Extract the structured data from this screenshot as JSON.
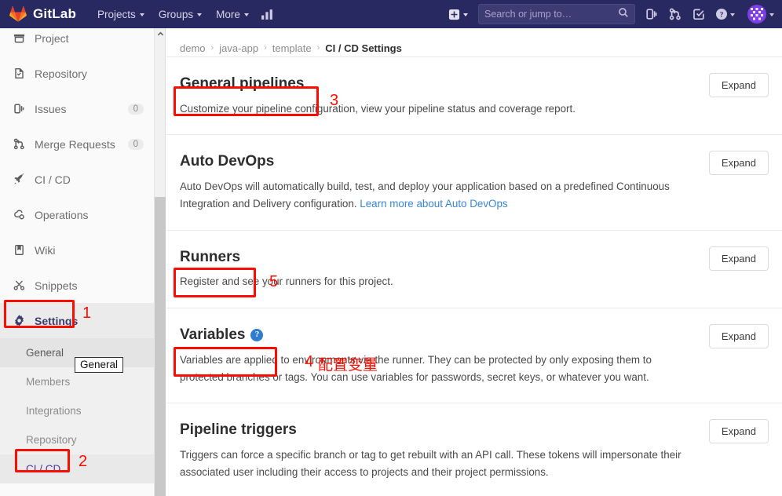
{
  "navbar": {
    "brand": "GitLab",
    "links": [
      {
        "label": "Projects",
        "icon": "chevron-down-icon"
      },
      {
        "label": "Groups",
        "icon": "chevron-down-icon"
      },
      {
        "label": "More",
        "icon": "chevron-down-icon"
      }
    ],
    "activity_icon": "analytics-chart-icon",
    "plus_icon": "plus-square-icon",
    "search": {
      "placeholder": "Search or jump to…",
      "value": "",
      "icon": "search-icon"
    },
    "right_icons": [
      {
        "name": "issues-icon"
      },
      {
        "name": "merge-request-icon"
      },
      {
        "name": "todos-check-icon"
      }
    ],
    "help_icon": "question-circle-icon",
    "avatar_icon": "user-avatar-identicon"
  },
  "sidebar": {
    "items": [
      {
        "label": "Project",
        "icon": "project-icon",
        "badge": null,
        "clipped": true
      },
      {
        "label": "Repository",
        "icon": "repository-icon",
        "badge": null
      },
      {
        "label": "Issues",
        "icon": "issues-icon",
        "badge": "0"
      },
      {
        "label": "Merge Requests",
        "icon": "merge-request-icon",
        "badge": "0"
      },
      {
        "label": "CI / CD",
        "icon": "rocket-icon",
        "badge": null
      },
      {
        "label": "Operations",
        "icon": "operations-icon",
        "badge": null
      },
      {
        "label": "Wiki",
        "icon": "wiki-book-icon",
        "badge": null
      },
      {
        "label": "Snippets",
        "icon": "snippets-scissors-icon",
        "badge": null
      },
      {
        "label": "Settings",
        "icon": "gear-icon",
        "badge": null,
        "active": true
      }
    ],
    "sub_items": [
      {
        "label": "General",
        "state": "highlighted"
      },
      {
        "label": "Members",
        "state": "normal"
      },
      {
        "label": "Integrations",
        "state": "normal"
      },
      {
        "label": "Repository",
        "state": "normal"
      },
      {
        "label": "CI / CD",
        "state": "active"
      }
    ],
    "tooltip": "General",
    "scrollbar": {
      "up_arrow_icon": "chevron-up-icon"
    }
  },
  "breadcrumb": {
    "items": [
      "demo",
      "java-app",
      "template"
    ],
    "current": "CI / CD Settings",
    "separator": "›"
  },
  "main": {
    "expand_label": "Expand",
    "sections": [
      {
        "title": "General pipelines",
        "desc": "Customize your pipeline configuration, view your pipeline status and coverage report.",
        "has_help": false
      },
      {
        "title": "Auto DevOps",
        "desc": "Auto DevOps will automatically build, test, and deploy your application based on a predefined Continuous Integration and Delivery configuration. ",
        "link": "Learn more about Auto DevOps",
        "has_help": false
      },
      {
        "title": "Runners",
        "desc": "Register and see your runners for this project.",
        "has_help": false
      },
      {
        "title": "Variables",
        "desc": "Variables are applied to environments via the runner. They can be protected by only exposing them to protected branches or tags. You can use variables for passwords, secret keys, or whatever you want.",
        "has_help": true,
        "help_icon": "question-mark-help-icon"
      },
      {
        "title": "Pipeline triggers",
        "desc": "Triggers can force a specific branch or tag to get rebuilt with an API call. These tokens will impersonate their associated user including their access to projects and their project permissions.",
        "has_help": false
      }
    ]
  },
  "annotations": {
    "color": "#fb0d00",
    "markers": [
      {
        "id": "settings",
        "number": "1",
        "text": null
      },
      {
        "id": "cicd-sub",
        "number": "2",
        "text": null
      },
      {
        "id": "general-pipelines",
        "number": "3",
        "text": null
      },
      {
        "id": "variables",
        "number": "4",
        "text": "配置变量"
      },
      {
        "id": "runners",
        "number": "5",
        "text": null
      }
    ]
  }
}
